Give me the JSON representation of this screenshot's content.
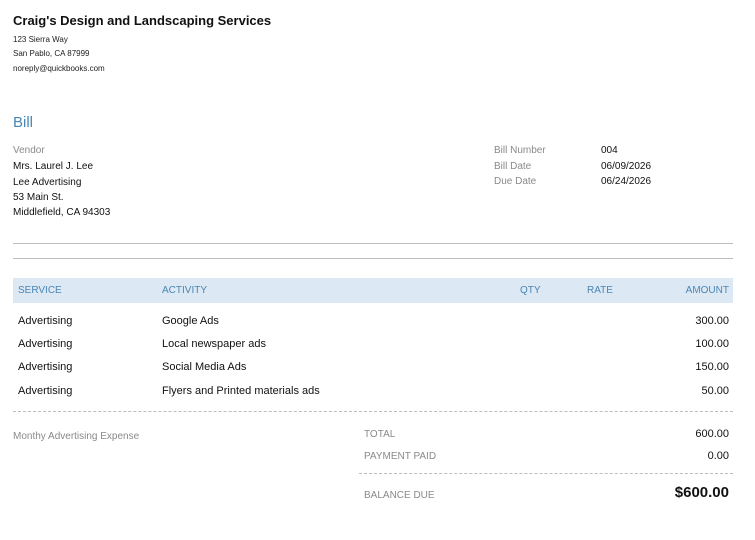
{
  "company": {
    "name": "Craig's Design and Landscaping Services",
    "address_line1": "123 Sierra Way",
    "address_line2": "San Pablo, CA  87999",
    "email": "noreply@quickbooks.com"
  },
  "document": {
    "title": "Bill"
  },
  "vendor": {
    "label": "Vendor",
    "name": "Mrs. Laurel J. Lee",
    "company": "Lee Advertising",
    "street": "53 Main St.",
    "city": "Middlefield, CA  94303"
  },
  "bill_info": {
    "number_label": "Bill Number",
    "number": "004",
    "date_label": "Bill Date",
    "date": "06/09/2026",
    "due_label": "Due Date",
    "due": "06/24/2026"
  },
  "table": {
    "headers": {
      "service": "SERVICE",
      "activity": "ACTIVITY",
      "qty": "QTY",
      "rate": "RATE",
      "amount": "AMOUNT"
    },
    "rows": [
      {
        "service": "Advertising",
        "activity": "Google Ads",
        "qty": "",
        "rate": "",
        "amount": "300.00"
      },
      {
        "service": "Advertising",
        "activity": "Local newspaper  ads",
        "qty": "",
        "rate": "",
        "amount": "100.00"
      },
      {
        "service": "Advertising",
        "activity": "Social Media Ads",
        "qty": "",
        "rate": "",
        "amount": "150.00"
      },
      {
        "service": "Advertising",
        "activity": "Flyers and Printed materials ads",
        "qty": "",
        "rate": "",
        "amount": "50.00"
      }
    ]
  },
  "memo": "Monthy Advertising Expense",
  "totals": {
    "total_label": "TOTAL",
    "total": "600.00",
    "paid_label": "PAYMENT PAID",
    "paid": "0.00",
    "balance_label": "BALANCE DUE",
    "balance": "$600.00"
  }
}
